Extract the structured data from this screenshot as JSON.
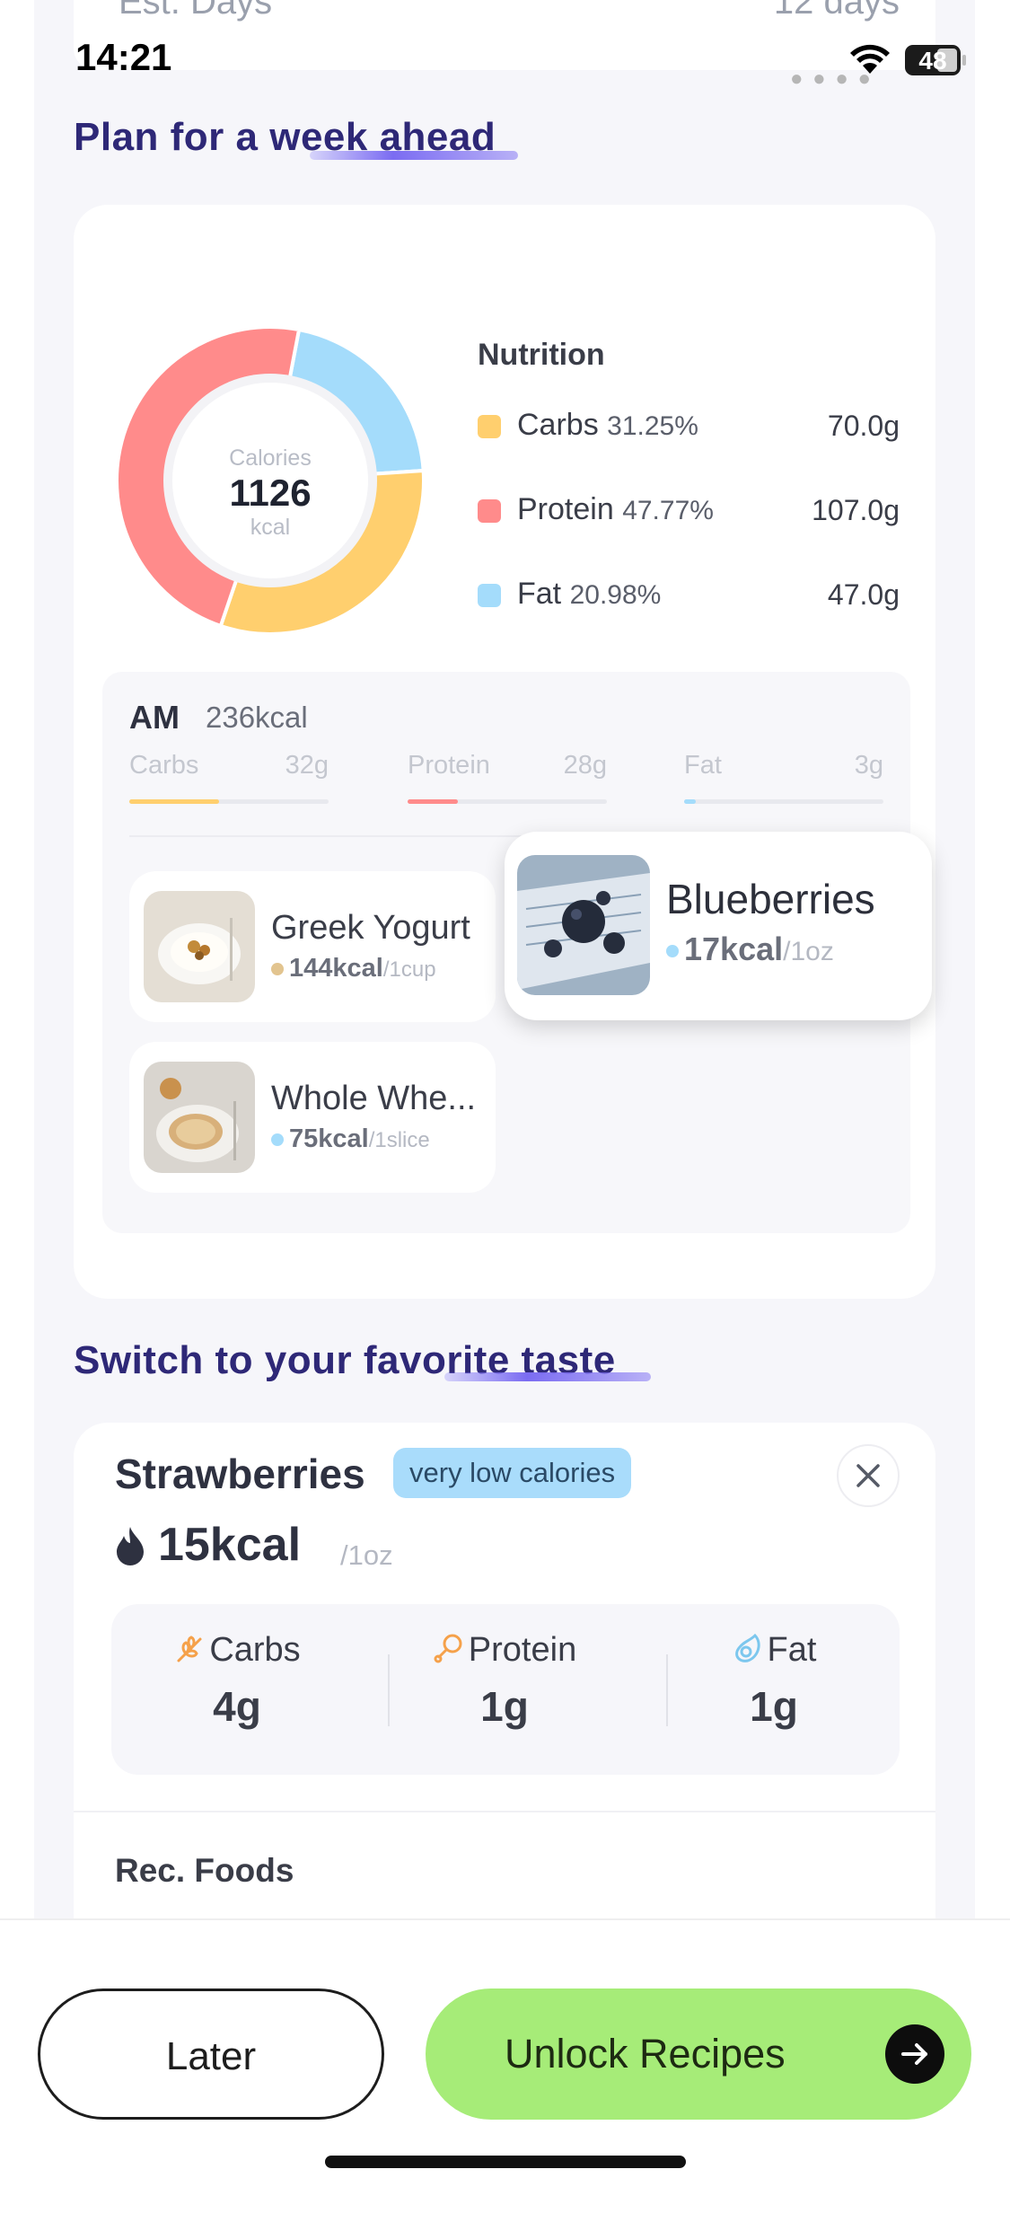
{
  "peek": {
    "left_text": "Est. Days",
    "right_text": "12 days"
  },
  "status_bar": {
    "time": "14:21",
    "battery": "48"
  },
  "plan_section": {
    "heading": "Plan for a week ahead"
  },
  "nutrition": {
    "calories_label": "Calories",
    "calories_value": "1126",
    "calories_unit": "kcal",
    "title": "Nutrition",
    "items": [
      {
        "name": "Carbs",
        "pct": "31.25%",
        "grams": "70.0g",
        "color": "#ffcf6e"
      },
      {
        "name": "Protein",
        "pct": "47.77%",
        "grams": "107.0g",
        "color": "#ff8b8b"
      },
      {
        "name": "Fat",
        "pct": "20.98%",
        "grams": "47.0g",
        "color": "#a4dcfb"
      }
    ],
    "donut_fractions": [
      0.3125,
      0.4777,
      0.2098
    ]
  },
  "meal": {
    "title": "AM",
    "kcal": "236kcal",
    "macros": [
      {
        "name": "Carbs",
        "grams": "32g",
        "color": "#ffcf6e",
        "fill": 0.45
      },
      {
        "name": "Protein",
        "grams": "28g",
        "color": "#ff8b8b",
        "fill": 0.25
      },
      {
        "name": "Fat",
        "grams": "3g",
        "color": "#a4dcfb",
        "fill": 0.06
      }
    ],
    "foods": [
      {
        "name": "Greek Yogurt",
        "kcal": "144kcal",
        "unit": "/1cup",
        "dot_color": "#e2c48f"
      },
      {
        "name": "Blueberries",
        "kcal": "17kcal",
        "unit": "/1oz",
        "dot_color": "#a4dcfb"
      },
      {
        "name": "Whole Whe...",
        "kcal": "75kcal",
        "unit": "/1slice",
        "dot_color": "#a4dcfb"
      }
    ]
  },
  "switch_section": {
    "heading": "Switch to your favorite taste"
  },
  "swap_card": {
    "name": "Strawberries",
    "tag": "very low calories",
    "kcal": "15kcal",
    "unit": "/1oz",
    "macros": [
      {
        "name": "Carbs",
        "value": "4g"
      },
      {
        "name": "Protein",
        "value": "1g"
      },
      {
        "name": "Fat",
        "value": "1g"
      }
    ],
    "rec_foods_label": "Rec. Foods"
  },
  "footer": {
    "later_label": "Later",
    "unlock_label": "Unlock Recipes"
  }
}
